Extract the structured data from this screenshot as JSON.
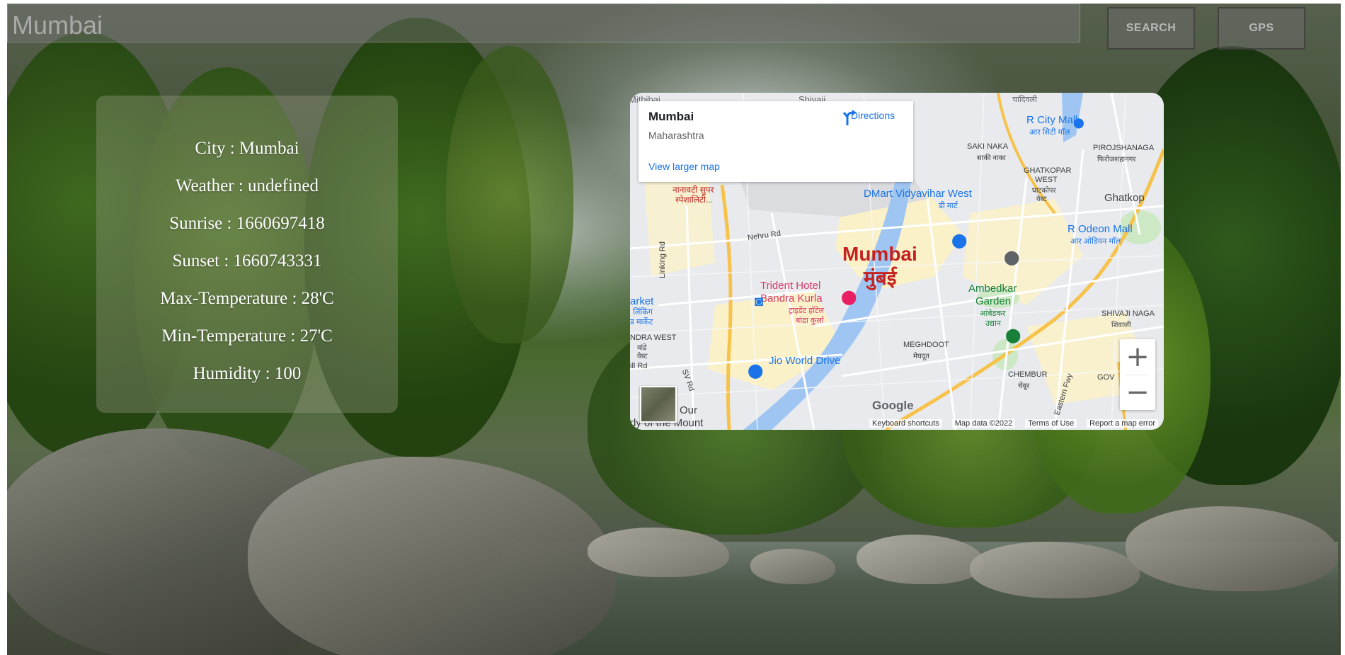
{
  "search": {
    "value": "Mumbai"
  },
  "buttons": {
    "search": "SEARCH",
    "gps": "GPS"
  },
  "weather": {
    "rows": [
      "City : Mumbai",
      "Weather : undefined",
      "Sunrise : 1660697418",
      "Sunset : 1660743331",
      "Max-Temperature : 28'C",
      "Min-Temperature : 27'C",
      "Humidity : 100"
    ]
  },
  "map": {
    "info": {
      "title": "Mumbai",
      "subtitle": "Maharashtra",
      "directions": "Directions",
      "larger_map": "View larger map"
    },
    "city_en": "Mumbai",
    "city_hi": "मुंबई",
    "places": {
      "mithibai": "Mithibai",
      "shivaji": "Shivaji",
      "chandivali": "चांदिवली",
      "r_city_mall": "R City Mall",
      "r_city_mall_hi": "आर सिटी मॉल",
      "saki_naka": "SAKI NAKA",
      "saki_naka_hi": "साकी नाका",
      "pirojshanagar": "PIROJSHANAGA",
      "pirojshanagar_hi": "फिरोजशहानगर",
      "ghatkopar_west": "GHATKOPAR",
      "ghatkopar_west2": "WEST",
      "ghatkopar_west_hi": "घाटकोपर",
      "ghatkopar_west_hi2": "वेस्ट",
      "nanavati": "नानावटी सुपर",
      "nanavati2": "स्पेशालिटी...",
      "dmart": "DMart Vidyavihar West",
      "dmart_hi": "डी मार्ट",
      "ghatkop": "Ghatkop",
      "r_odeon": "R Odeon Mall",
      "r_odeon_hi": "आर ओडियन मॉल",
      "nehru_rd": "Nehru Rd",
      "linking_rd": "Linking Rd",
      "trident": "Trident Hotel",
      "trident2": "Bandra Kurla",
      "trident_hi": "ट्राइडेंट हॉटेल",
      "trident_hi2": "बांद्रा कुर्ला",
      "market": "arket",
      "market_hi": "लिंकिंग",
      "market_hi2": "ड मार्केट",
      "ambedkar": "Ambedkar",
      "ambedkar2": "Garden",
      "ambedkar_hi": "आंबेडकर",
      "ambedkar_hi2": "उद्यान",
      "shivaji_nagar": "SHIVAJI NAGA",
      "shivaji_nagar_hi": "शिवाजी",
      "bandra_west": "NDRA WEST",
      "bandra_west_hi": "वांद्रे",
      "bandra_west_hi2": "वेस्ट",
      "meghdoot": "MEGHDOOT",
      "meghdoot_hi": "मेघदूत",
      "jio": "Jio World Drive",
      "hill_rd": "ill Rd",
      "sv_rd": "SV Rd",
      "chembur": "CHEMBUR",
      "chembur_hi": "चेंबूर",
      "govt": "GOV",
      "our": "Our",
      "mount": "dy of the Mount",
      "eastern_fwy": "Eastern Fwy"
    },
    "zoom_in": "+",
    "zoom_out": "−",
    "google": "Google",
    "attribution": {
      "shortcuts": "Keyboard shortcuts",
      "data": "Map data ©2022",
      "terms": "Terms of Use",
      "report": "Report a map error"
    }
  }
}
